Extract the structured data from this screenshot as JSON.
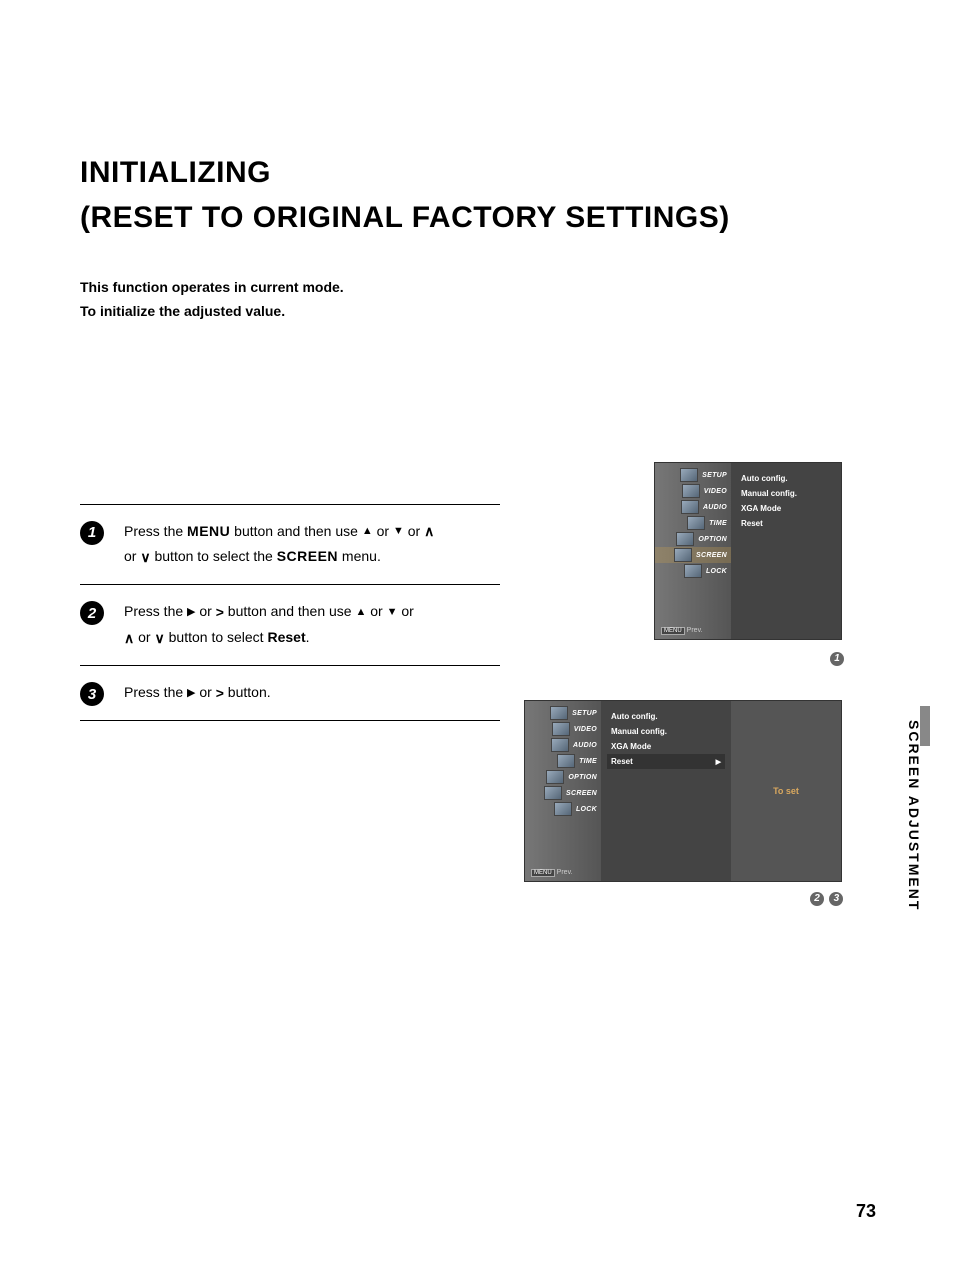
{
  "title_line1": "INITIALIZING",
  "title_line2": "(RESET TO ORIGINAL FACTORY SETTINGS)",
  "intro_line1": "This function operates in current mode.",
  "intro_line2": "To initialize the adjusted value.",
  "steps": {
    "s1": {
      "num": "1",
      "prefix": "Press the ",
      "kw1": "MENU",
      "mid1": " button and then use ",
      "up": "▲",
      "or1": " or ",
      "down": "▼",
      "or2": "   or  ",
      "oup": "∧",
      "line2a": "or  ",
      "odown": "∨",
      "line2b": "  button to select the ",
      "kw2": "SCREEN",
      "line2c": " menu."
    },
    "s2": {
      "num": "2",
      "prefix": "Press the ",
      "r": "▶",
      "or1": "  or  ",
      "gt": ">",
      "mid1": "  button and then use ",
      "up": "▲",
      "or2": " or ",
      "down": "▼",
      "or3": "  or ",
      "line2a": " ",
      "oup": "∧",
      "line2b": "  or  ",
      "odown": "∨",
      "line2c": "    button to select ",
      "kw": "Reset",
      "dot": "."
    },
    "s3": {
      "num": "3",
      "prefix": "Press the ",
      "r": "▶",
      "or1": "  or  ",
      "gt": ">",
      "suffix": "  button."
    }
  },
  "osd": {
    "side": [
      "SETUP",
      "VIDEO",
      "AUDIO",
      "TIME",
      "OPTION",
      "SCREEN",
      "LOCK"
    ],
    "opts": [
      "Auto config.",
      "Manual config.",
      "XGA Mode",
      "Reset"
    ],
    "prev": "Prev.",
    "prev_btn": "MENU",
    "to_set": "To set"
  },
  "callouts": {
    "c1": "1",
    "c2": "2",
    "c3": "3"
  },
  "side_label": "SCREEN ADJUSTMENT",
  "page_number": "73"
}
